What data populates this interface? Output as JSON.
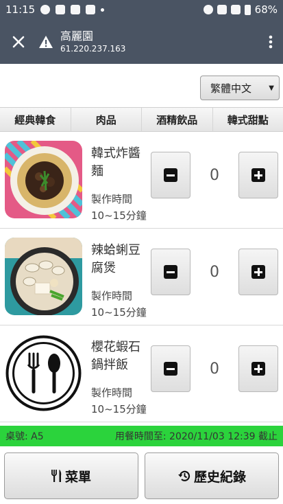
{
  "status_bar": {
    "time": "11:15",
    "battery": "68%"
  },
  "app_bar": {
    "title": "高麗園",
    "subtitle": "61.220.237.163"
  },
  "language": {
    "selected": "繁體中文"
  },
  "tabs": [
    {
      "label": "經典韓食"
    },
    {
      "label": "肉品"
    },
    {
      "label": "酒精飲品"
    },
    {
      "label": "韓式甜點"
    }
  ],
  "items": [
    {
      "name": "韓式炸醬麵",
      "time_label": "製作時間",
      "time_value": "10~15分鐘",
      "qty": "0"
    },
    {
      "name": "辣蛤蜊豆腐煲",
      "time_label": "製作時間",
      "time_value": "10~15分鐘",
      "qty": "0"
    },
    {
      "name": "櫻花蝦石鍋拌飯",
      "time_label": "製作時間",
      "time_value": "10~15分鐘",
      "qty": "0"
    }
  ],
  "info_bar": {
    "table": "桌號: A5",
    "deadline": "用餐時間至: 2020/11/03 12:39 截止"
  },
  "bottom": {
    "menu_label": "菜單",
    "history_label": "歷史紀錄"
  },
  "colors": {
    "header": "#4a5463",
    "info_bar": "#2bd33c"
  }
}
